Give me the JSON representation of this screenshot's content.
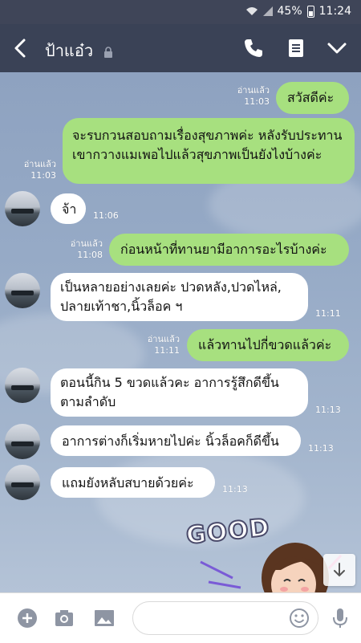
{
  "status": {
    "battery": "45%",
    "time": "11:24"
  },
  "header": {
    "contact_name": "ป้าแอ๋ว"
  },
  "messages": [
    {
      "dir": "out",
      "text": "สวัสดีค่ะ",
      "read": "อ่านแล้ว",
      "time": "11:03"
    },
    {
      "dir": "out",
      "text": "จะรบกวนสอบถามเรื่องสุขภาพค่ะ หลังรับประทานเขากวางแมเพอไปแล้วสุขภาพเป็นยังไงบ้างค่ะ",
      "read": "อ่านแล้ว",
      "time": "11:03"
    },
    {
      "dir": "in",
      "text": "จ้า",
      "time": "11:06"
    },
    {
      "dir": "out",
      "text": "ก่อนหน้าที่ทานยามีอาการอะไรบ้างค่ะ",
      "read": "อ่านแล้ว",
      "time": "11:08"
    },
    {
      "dir": "in",
      "text": "เป็นหลายอย่างเลยค่ะ ปวดหลัง,ปวดไหล่, ปลายเท้าชา,นิ้วล็อค ฯ",
      "time": "11:11"
    },
    {
      "dir": "out",
      "text": "แล้วทานไปกี่ขวดแล้วค่ะ",
      "read": "อ่านแล้ว",
      "time": "11:11"
    },
    {
      "dir": "in",
      "text": "ตอนนี้กิน 5 ขวดแล้วคะ  อาการรู้สึกดีขึ้นตามลำดับ",
      "time": "11:13"
    },
    {
      "dir": "in",
      "text": "อาการต่างก็เริ่มหายไปค่ะ นิ้วล็อคก็ดีขึ้น",
      "time": "11:13"
    },
    {
      "dir": "in",
      "text": "แถมยังหลับสบายด้วยค่ะ",
      "time": "11:13"
    }
  ],
  "sticker": {
    "text": "GOOD"
  },
  "icons": {
    "status": [
      "wifi-icon",
      "signal-icon",
      "battery-icon"
    ],
    "header": [
      "back-arrow-icon",
      "lock-icon",
      "phone-icon",
      "notes-icon",
      "chevron-down-icon"
    ],
    "bottom": [
      "plus-icon",
      "camera-icon",
      "image-icon",
      "emoji-icon",
      "microphone-icon"
    ]
  },
  "colors": {
    "outgoing": "#a7e07f",
    "incoming": "#ffffff",
    "header": "#3a4256"
  }
}
